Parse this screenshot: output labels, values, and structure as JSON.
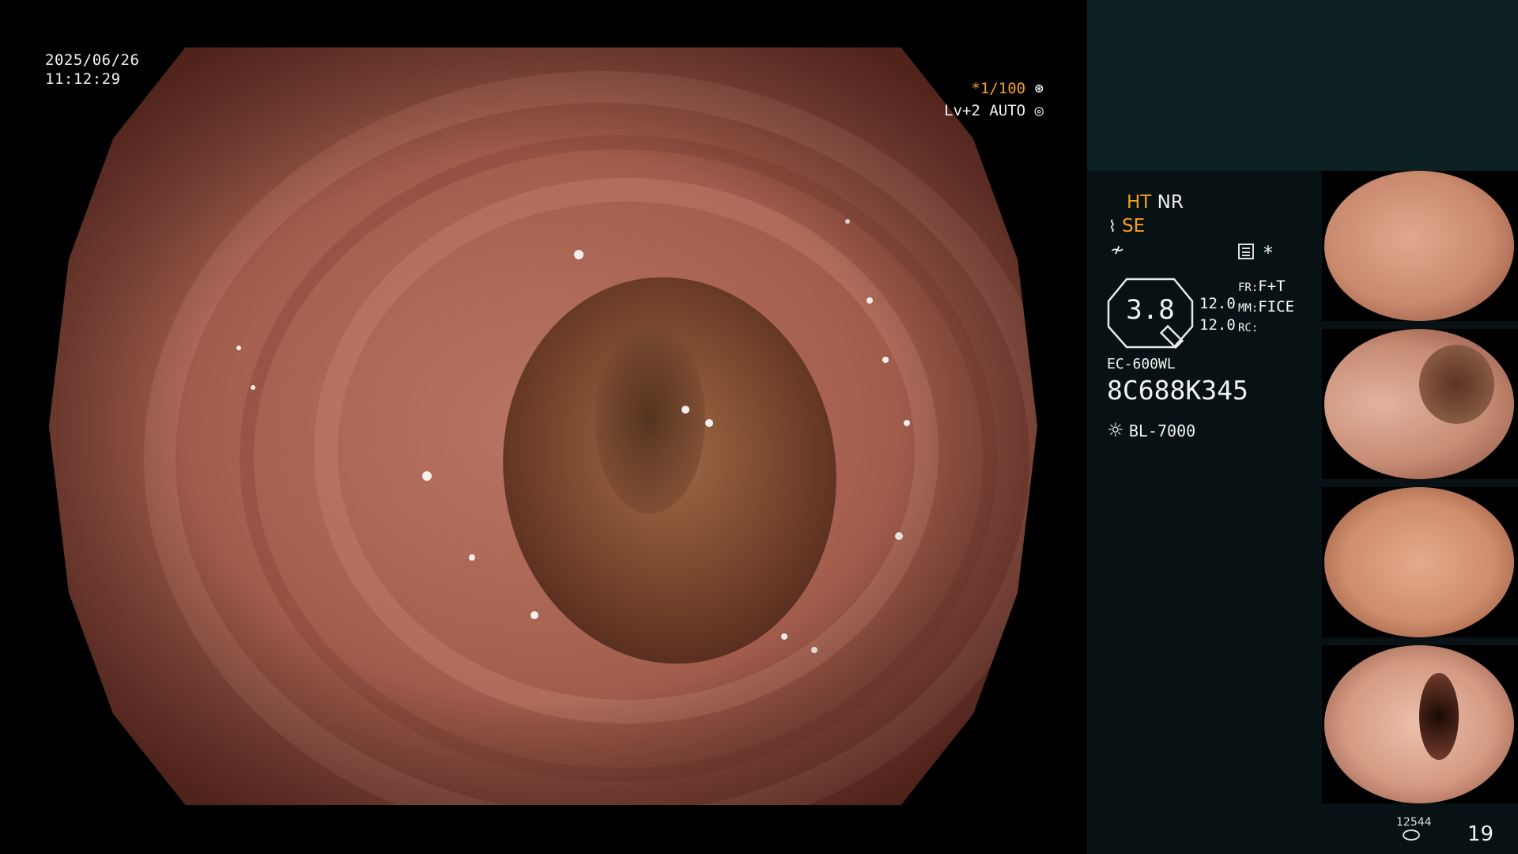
{
  "datetime": {
    "date": "2025/06/26",
    "time": "11:12:29"
  },
  "hud": {
    "shutter": "*1/100",
    "level": "Lv+2 AUTO"
  },
  "indicators": {
    "ht": "HT",
    "nr": "NR",
    "se": "SE",
    "zoom": "3.8",
    "val1": "12.0",
    "val2": "12.0",
    "fr_label": "FR:",
    "fr_value": "F+T",
    "mm_label": "MM:",
    "mm_value": "FICE",
    "rc_label": "RC:",
    "asterisk": "*"
  },
  "device": {
    "model": "EC-600WL",
    "serial": "8C688K345",
    "light_source": "BL-7000"
  },
  "storage": {
    "count_small": "12544",
    "count": "19"
  },
  "thumbnails": [
    {
      "name": "thumb-1",
      "color": "#c98a6e"
    },
    {
      "name": "thumb-2",
      "color": "#c78c74"
    },
    {
      "name": "thumb-3",
      "color": "#cf8e6c"
    },
    {
      "name": "thumb-4",
      "color": "#d49a82"
    }
  ],
  "colors": {
    "accent": "#f0a020",
    "panel": "#081214",
    "panel_top": "#0d2022"
  }
}
